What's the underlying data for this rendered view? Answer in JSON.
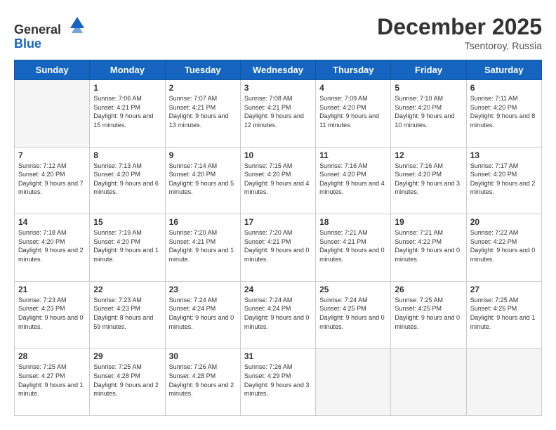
{
  "header": {
    "logo_general": "General",
    "logo_blue": "Blue",
    "month_title": "December 2025",
    "location": "Tsentoroy, Russia"
  },
  "days_of_week": [
    "Sunday",
    "Monday",
    "Tuesday",
    "Wednesday",
    "Thursday",
    "Friday",
    "Saturday"
  ],
  "weeks": [
    [
      {
        "day": "",
        "sunrise": "",
        "sunset": "",
        "daylight": ""
      },
      {
        "day": "1",
        "sunrise": "Sunrise: 7:06 AM",
        "sunset": "Sunset: 4:21 PM",
        "daylight": "Daylight: 9 hours and 15 minutes."
      },
      {
        "day": "2",
        "sunrise": "Sunrise: 7:07 AM",
        "sunset": "Sunset: 4:21 PM",
        "daylight": "Daylight: 9 hours and 13 minutes."
      },
      {
        "day": "3",
        "sunrise": "Sunrise: 7:08 AM",
        "sunset": "Sunset: 4:21 PM",
        "daylight": "Daylight: 9 hours and 12 minutes."
      },
      {
        "day": "4",
        "sunrise": "Sunrise: 7:09 AM",
        "sunset": "Sunset: 4:20 PM",
        "daylight": "Daylight: 9 hours and 11 minutes."
      },
      {
        "day": "5",
        "sunrise": "Sunrise: 7:10 AM",
        "sunset": "Sunset: 4:20 PM",
        "daylight": "Daylight: 9 hours and 10 minutes."
      },
      {
        "day": "6",
        "sunrise": "Sunrise: 7:11 AM",
        "sunset": "Sunset: 4:20 PM",
        "daylight": "Daylight: 9 hours and 8 minutes."
      }
    ],
    [
      {
        "day": "7",
        "sunrise": "Sunrise: 7:12 AM",
        "sunset": "Sunset: 4:20 PM",
        "daylight": "Daylight: 9 hours and 7 minutes."
      },
      {
        "day": "8",
        "sunrise": "Sunrise: 7:13 AM",
        "sunset": "Sunset: 4:20 PM",
        "daylight": "Daylight: 9 hours and 6 minutes."
      },
      {
        "day": "9",
        "sunrise": "Sunrise: 7:14 AM",
        "sunset": "Sunset: 4:20 PM",
        "daylight": "Daylight: 9 hours and 5 minutes."
      },
      {
        "day": "10",
        "sunrise": "Sunrise: 7:15 AM",
        "sunset": "Sunset: 4:20 PM",
        "daylight": "Daylight: 9 hours and 4 minutes."
      },
      {
        "day": "11",
        "sunrise": "Sunrise: 7:16 AM",
        "sunset": "Sunset: 4:20 PM",
        "daylight": "Daylight: 9 hours and 4 minutes."
      },
      {
        "day": "12",
        "sunrise": "Sunrise: 7:16 AM",
        "sunset": "Sunset: 4:20 PM",
        "daylight": "Daylight: 9 hours and 3 minutes."
      },
      {
        "day": "13",
        "sunrise": "Sunrise: 7:17 AM",
        "sunset": "Sunset: 4:20 PM",
        "daylight": "Daylight: 9 hours and 2 minutes."
      }
    ],
    [
      {
        "day": "14",
        "sunrise": "Sunrise: 7:18 AM",
        "sunset": "Sunset: 4:20 PM",
        "daylight": "Daylight: 9 hours and 2 minutes."
      },
      {
        "day": "15",
        "sunrise": "Sunrise: 7:19 AM",
        "sunset": "Sunset: 4:20 PM",
        "daylight": "Daylight: 9 hours and 1 minute."
      },
      {
        "day": "16",
        "sunrise": "Sunrise: 7:20 AM",
        "sunset": "Sunset: 4:21 PM",
        "daylight": "Daylight: 9 hours and 1 minute."
      },
      {
        "day": "17",
        "sunrise": "Sunrise: 7:20 AM",
        "sunset": "Sunset: 4:21 PM",
        "daylight": "Daylight: 9 hours and 0 minutes."
      },
      {
        "day": "18",
        "sunrise": "Sunrise: 7:21 AM",
        "sunset": "Sunset: 4:21 PM",
        "daylight": "Daylight: 9 hours and 0 minutes."
      },
      {
        "day": "19",
        "sunrise": "Sunrise: 7:21 AM",
        "sunset": "Sunset: 4:22 PM",
        "daylight": "Daylight: 9 hours and 0 minutes."
      },
      {
        "day": "20",
        "sunrise": "Sunrise: 7:22 AM",
        "sunset": "Sunset: 4:22 PM",
        "daylight": "Daylight: 9 hours and 0 minutes."
      }
    ],
    [
      {
        "day": "21",
        "sunrise": "Sunrise: 7:23 AM",
        "sunset": "Sunset: 4:23 PM",
        "daylight": "Daylight: 9 hours and 0 minutes."
      },
      {
        "day": "22",
        "sunrise": "Sunrise: 7:23 AM",
        "sunset": "Sunset: 4:23 PM",
        "daylight": "Daylight: 8 hours and 59 minutes."
      },
      {
        "day": "23",
        "sunrise": "Sunrise: 7:24 AM",
        "sunset": "Sunset: 4:24 PM",
        "daylight": "Daylight: 9 hours and 0 minutes."
      },
      {
        "day": "24",
        "sunrise": "Sunrise: 7:24 AM",
        "sunset": "Sunset: 4:24 PM",
        "daylight": "Daylight: 9 hours and 0 minutes."
      },
      {
        "day": "25",
        "sunrise": "Sunrise: 7:24 AM",
        "sunset": "Sunset: 4:25 PM",
        "daylight": "Daylight: 9 hours and 0 minutes."
      },
      {
        "day": "26",
        "sunrise": "Sunrise: 7:25 AM",
        "sunset": "Sunset: 4:25 PM",
        "daylight": "Daylight: 9 hours and 0 minutes."
      },
      {
        "day": "27",
        "sunrise": "Sunrise: 7:25 AM",
        "sunset": "Sunset: 4:26 PM",
        "daylight": "Daylight: 9 hours and 1 minute."
      }
    ],
    [
      {
        "day": "28",
        "sunrise": "Sunrise: 7:25 AM",
        "sunset": "Sunset: 4:27 PM",
        "daylight": "Daylight: 9 hours and 1 minute."
      },
      {
        "day": "29",
        "sunrise": "Sunrise: 7:25 AM",
        "sunset": "Sunset: 4:28 PM",
        "daylight": "Daylight: 9 hours and 2 minutes."
      },
      {
        "day": "30",
        "sunrise": "Sunrise: 7:26 AM",
        "sunset": "Sunset: 4:28 PM",
        "daylight": "Daylight: 9 hours and 2 minutes."
      },
      {
        "day": "31",
        "sunrise": "Sunrise: 7:26 AM",
        "sunset": "Sunset: 4:29 PM",
        "daylight": "Daylight: 9 hours and 3 minutes."
      },
      {
        "day": "",
        "sunrise": "",
        "sunset": "",
        "daylight": ""
      },
      {
        "day": "",
        "sunrise": "",
        "sunset": "",
        "daylight": ""
      },
      {
        "day": "",
        "sunrise": "",
        "sunset": "",
        "daylight": ""
      }
    ]
  ]
}
